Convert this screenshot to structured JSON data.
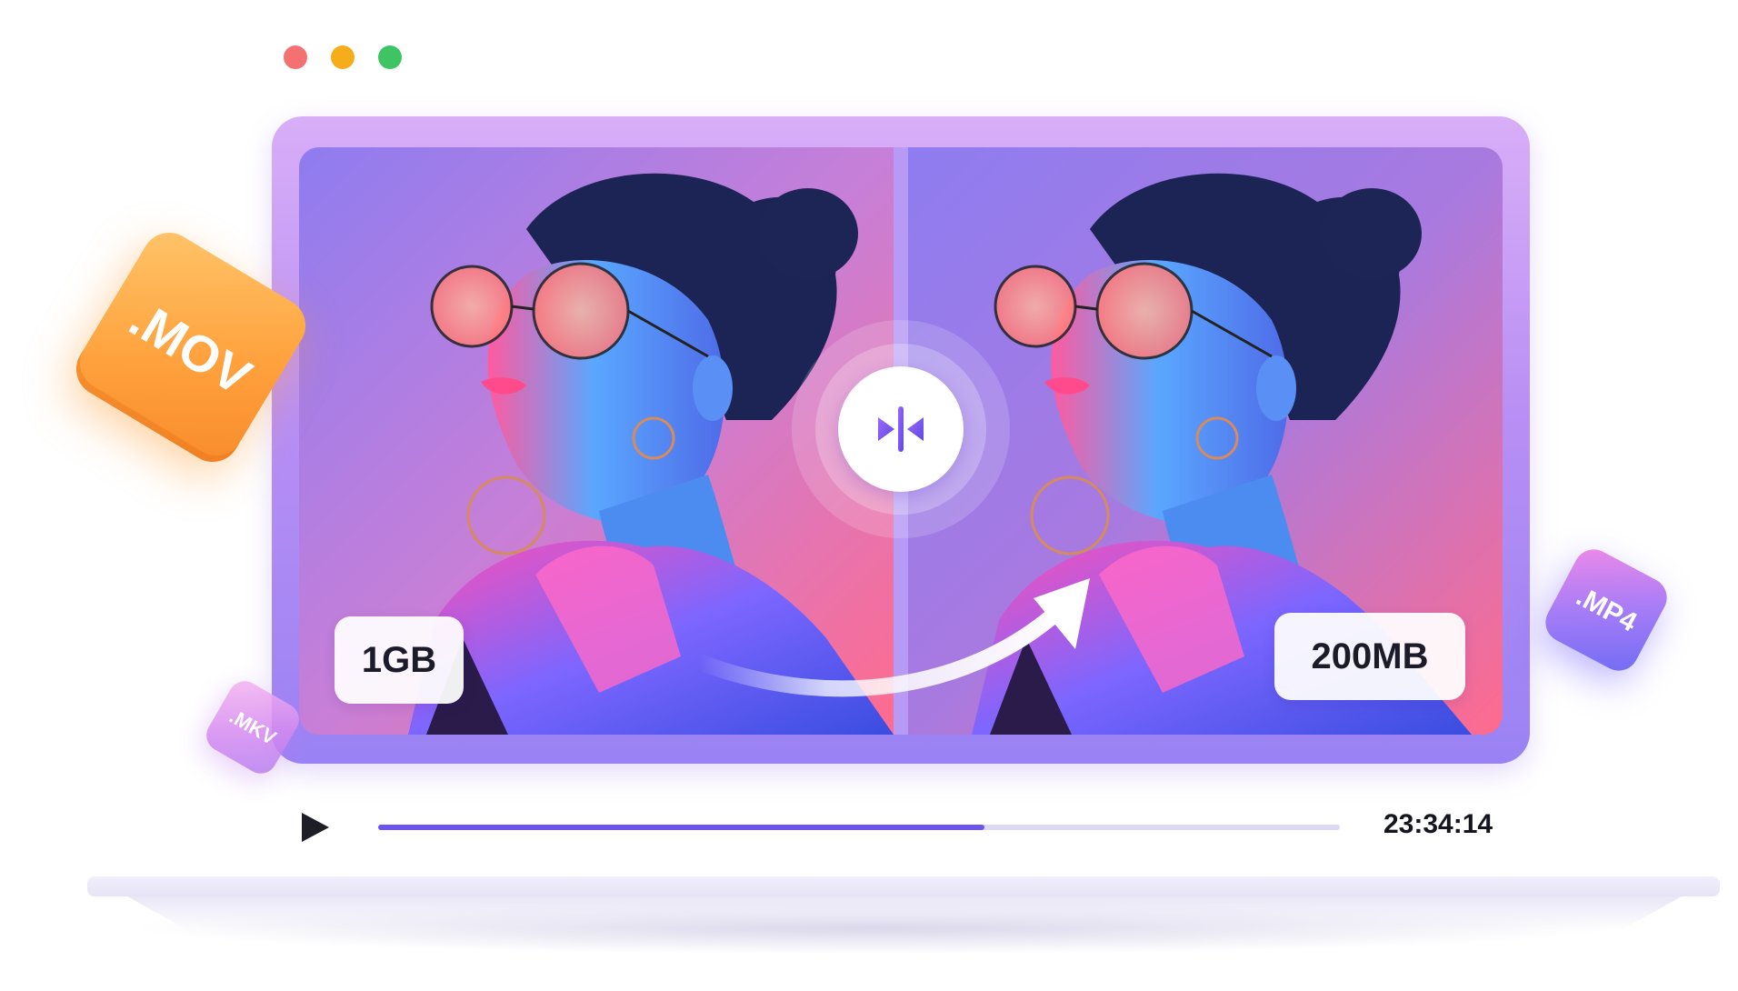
{
  "window": {
    "controls": [
      {
        "name": "close",
        "color": "#f47171"
      },
      {
        "name": "minimize",
        "color": "#f6ad1c"
      },
      {
        "name": "maximize",
        "color": "#3ec463"
      }
    ]
  },
  "preview": {
    "original_size": "1GB",
    "compressed_size": "200MB",
    "compare_icon": "split-compare-icon",
    "arrow_icon": "curved-arrow-icon"
  },
  "formats": {
    "mov": ".MOV",
    "mp4": ".MP4",
    "mkv": ".MKV"
  },
  "player": {
    "play_icon": "play-icon",
    "progress": 0.63,
    "time": "23:34:14"
  },
  "colors": {
    "frame": "#b98ff4",
    "accent": "#6a55f0",
    "track": "#ddd8f8"
  }
}
